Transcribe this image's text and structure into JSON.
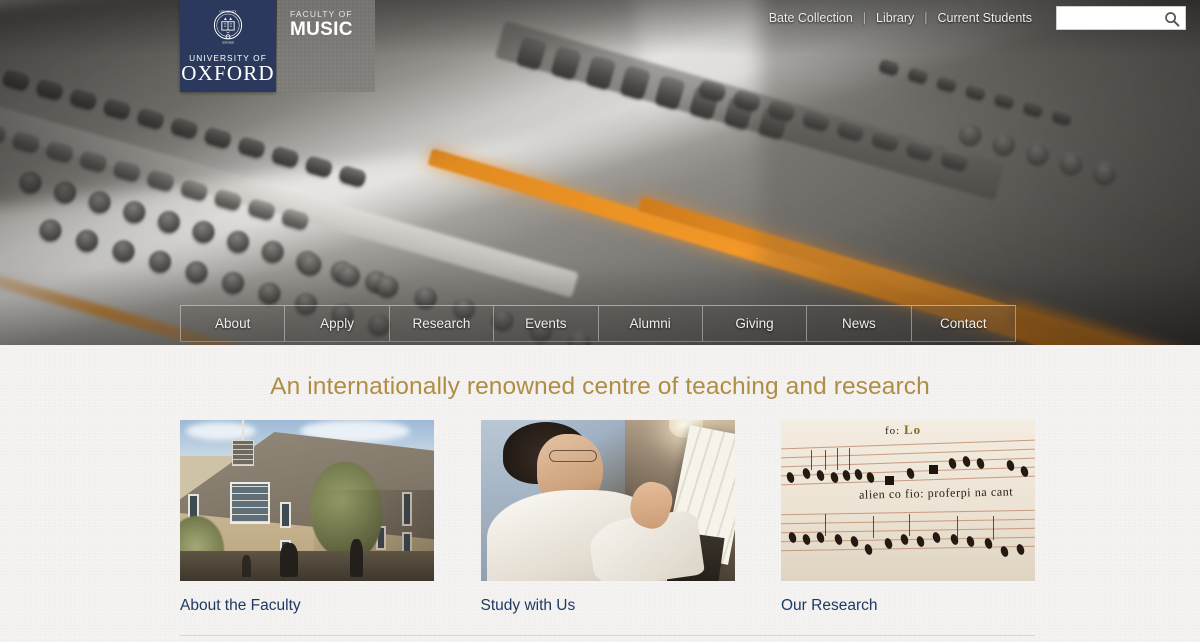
{
  "site": {
    "university_sub": "UNIVERSITY OF",
    "university_name": "OXFORD",
    "faculty_sub": "FACULTY OF",
    "faculty_name": "MUSIC"
  },
  "topbar": {
    "links": [
      {
        "label": "Bate Collection"
      },
      {
        "label": "Library"
      },
      {
        "label": "Current Students"
      }
    ],
    "separator": "|",
    "search": {
      "value": "",
      "placeholder": "",
      "icon": "search-icon"
    }
  },
  "mainnav": {
    "items": [
      {
        "label": "About"
      },
      {
        "label": "Apply"
      },
      {
        "label": "Research"
      },
      {
        "label": "Events"
      },
      {
        "label": "Alumni"
      },
      {
        "label": "Giving"
      },
      {
        "label": "News"
      },
      {
        "label": "Contact"
      }
    ]
  },
  "hero": {
    "description": "audio mixing console close-up",
    "accent_color": "#e8902a"
  },
  "main": {
    "headline": "An internationally renowned centre of teaching and research",
    "headline_color": "#b08d45",
    "link_color": "#1f3864",
    "cards": [
      {
        "label": "About the Faculty",
        "image": "faculty-building-photo"
      },
      {
        "label": "Study with Us",
        "image": "man-reading-score-photo"
      },
      {
        "label": "Our Research",
        "image": "medieval-manuscript-photo"
      }
    ]
  },
  "manuscript": {
    "heading_left": "fo:",
    "heading_right": "Lo",
    "lyric": "alien co fio: proferpi na cant"
  }
}
